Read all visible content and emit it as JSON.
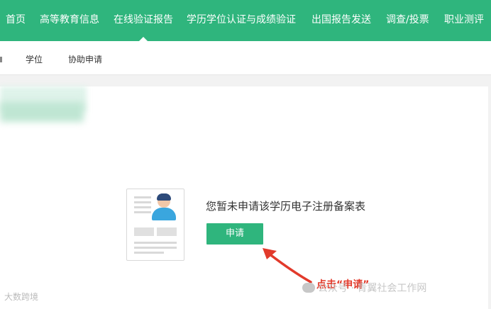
{
  "top_nav": {
    "items": [
      "首页",
      "高等教育信息",
      "在线验证报告",
      "学历学位认证与成绩验证",
      "出国报告发送",
      "调查/投票",
      "职业测评"
    ],
    "active_index": 2
  },
  "sub_nav": {
    "items": [
      "学位",
      "协助申请"
    ]
  },
  "main": {
    "empty_message": "您暂未申请该学历电子注册备案表",
    "apply_label": "申请"
  },
  "annotation": {
    "text": "点击“申请”"
  },
  "watermarks": {
    "left": "大数跨境",
    "right": "公众号 · 青翼社会工作网"
  },
  "colors": {
    "brand_green": "#2fb57d",
    "annotation_red": "#e23a2b"
  }
}
